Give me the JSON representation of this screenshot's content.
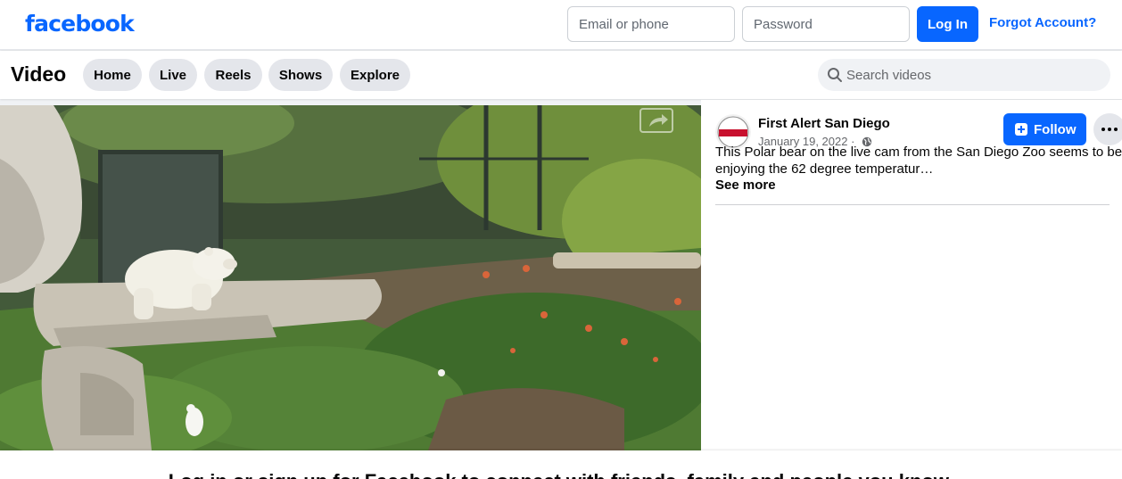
{
  "colors": {
    "brand": "#0866ff",
    "text": "#050505",
    "secondary_text": "#65676b",
    "pill_bg": "#e4e6eb"
  },
  "header": {
    "logo_text": "facebook",
    "email_placeholder": "Email or phone",
    "password_placeholder": "Password",
    "login_label": "Log In",
    "forgot_label": "Forgot Account?"
  },
  "video_nav": {
    "title": "Video",
    "tabs": [
      {
        "label": "Home"
      },
      {
        "label": "Live"
      },
      {
        "label": "Reels"
      },
      {
        "label": "Shows"
      },
      {
        "label": "Explore"
      }
    ],
    "search_placeholder": "Search videos",
    "search_icon": "search-icon"
  },
  "player": {
    "share_icon": "share-icon"
  },
  "post": {
    "page_name": "First Alert San Diego",
    "avatar_lines": [
      "FIRST ALERT",
      "San Diego",
      "NEWS"
    ],
    "date": "January 19, 2022 ·",
    "audience_icon": "globe-icon",
    "follow_label": "Follow",
    "follow_icon": "add-page-icon",
    "more_icon": "ellipsis-icon",
    "caption_line1": "This Polar bear on the live cam from the San Diego Zoo seems to be",
    "caption_line2": "enjoying the 62 degree temperatur…",
    "see_more_label": "See more"
  },
  "signup_prompt": "Log in or sign up for Facebook to connect with friends, family and people you know."
}
